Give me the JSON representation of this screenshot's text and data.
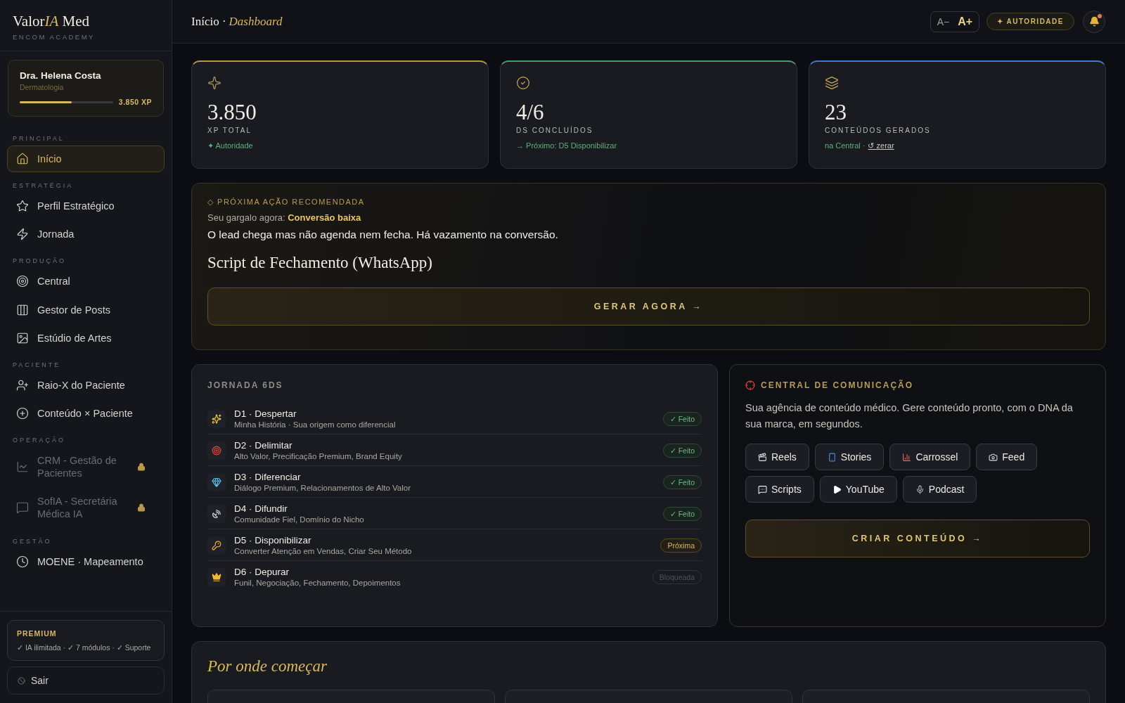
{
  "brand": {
    "name_start": "Valor",
    "name_accent": "IA",
    "name_end": " Med",
    "subtitle": "ENCOM ACADEMY"
  },
  "profile": {
    "name": "Dra. Helena Costa",
    "specialty": "Dermatologia",
    "level": 0.56,
    "xp": "3.850 XP"
  },
  "nav_sections": [
    {
      "title": "PRINCIPAL",
      "items": [
        {
          "label": "Início",
          "selected": true,
          "locked": false
        }
      ]
    },
    {
      "title": "ESTRATÉGIA",
      "items": [
        {
          "label": "Perfil Estratégico",
          "selected": false,
          "locked": false
        },
        {
          "label": "Jornada",
          "selected": false,
          "locked": false
        }
      ]
    },
    {
      "title": "PRODUÇÃO",
      "items": [
        {
          "label": "Central",
          "selected": false,
          "locked": false
        },
        {
          "label": "Gestor de Posts",
          "selected": false,
          "locked": false
        },
        {
          "label": "Estúdio de Artes",
          "selected": false,
          "locked": false
        }
      ]
    },
    {
      "title": "PACIENTE",
      "items": [
        {
          "label": "Raio-X do Paciente",
          "selected": false,
          "locked": false
        },
        {
          "label": "Conteúdo × Paciente",
          "selected": false,
          "locked": false
        }
      ]
    },
    {
      "title": "OPERAÇÃO",
      "items": [
        {
          "label": "CRM - Gestão de Pacientes",
          "selected": false,
          "locked": true
        },
        {
          "label": "SofIA - Secretária Médica IA",
          "selected": false,
          "locked": true
        }
      ]
    },
    {
      "title": "GESTÃO",
      "items": [
        {
          "label": "MOENE · Mapeamento",
          "selected": false,
          "locked": false
        }
      ]
    }
  ],
  "plan": {
    "title": "PREMIUM",
    "features": "✓ IA ilimitada · ✓ 7 módulos · ✓ Suporte"
  },
  "logout": "Sair",
  "header": {
    "crumb": "Início ·",
    "page": "Dashboard",
    "font_down": "A−",
    "font_up": "A+",
    "badge": "✦ AUTORIDADE",
    "notification": true
  },
  "stats": [
    {
      "value": "3.850",
      "label": "XP TOTAL",
      "note": "✦ Autoridade"
    },
    {
      "value": "4/6",
      "label": "DS CONCLUÍDOS",
      "note": "→ Próximo: D5 Disponibilizar"
    },
    {
      "value": "23",
      "label": "CONTEÚDOS GERADOS",
      "note": "na Central ·",
      "link": "↺ zerar"
    }
  ],
  "recommendation": {
    "eyebrow": "◇ PRÓXIMA AÇÃO RECOMENDADA",
    "bottleneck": "Seu gargalo agora: **Conversão baixa**",
    "description": "O lead chega mas não agenda nem fecha. Há vazamento na conversão.",
    "title": "Script de Fechamento (WhatsApp)",
    "button": "GERAR AGORA →"
  },
  "journey": {
    "title": "JORNADA 6DS",
    "steps": [
      {
        "name": "D1 · Despertar",
        "detail": "Minha História · Sua origem como diferencial",
        "kind": "done",
        "badge": "✓ Feito"
      },
      {
        "name": "D2 · Delimitar",
        "detail": "Alto Valor, Precificação Premium, Brand Equity",
        "kind": "done",
        "badge": "✓ Feito"
      },
      {
        "name": "D3 · Diferenciar",
        "detail": "Diálogo Premium, Relacionamentos de Alto Valor",
        "kind": "done",
        "badge": "✓ Feito"
      },
      {
        "name": "D4 · Difundir",
        "detail": "Comunidade Fiel, Domínio do Nicho",
        "kind": "done",
        "badge": "✓ Feito"
      },
      {
        "name": "D5 · Disponibilizar",
        "detail": "Converter Atenção em Vendas, Criar Seu Método",
        "kind": "next",
        "badge": "Próxima"
      },
      {
        "name": "D6 · Depurar",
        "detail": "Funil, Negociação, Fechamento, Depoimentos",
        "kind": "locked",
        "badge": "Bloqueada"
      }
    ]
  },
  "central": {
    "title": "CENTRAL DE COMUNICAÇÃO",
    "description": "Sua agência de conteúdo médico. Gere conteúdo pronto, com o DNA da sua marca, em segundos.",
    "formats": [
      "Reels",
      "Stories",
      "Carrossel",
      "Feed",
      "Scripts",
      "YouTube",
      "Podcast"
    ],
    "button": "CRIAR CONTEÚDO →"
  },
  "start": {
    "title": "Por onde começar"
  }
}
